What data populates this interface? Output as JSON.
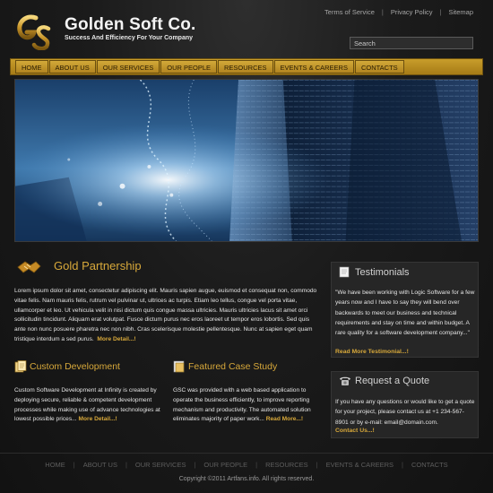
{
  "brand": {
    "name": "Golden Soft Co.",
    "tagline": "Success And Efficiency For Your Company",
    "colors": {
      "gold": "#d7a83a",
      "nav": "#b8891f"
    }
  },
  "top_links": [
    "Terms of Service",
    "Privacy Policy",
    "Sitemap"
  ],
  "search": {
    "placeholder": "Search"
  },
  "nav": [
    "HOME",
    "ABOUT US",
    "OUR SERVICES",
    "OUR PEOPLE",
    "RESOURCES",
    "EVENTS & CAREERS",
    "CONTACTS"
  ],
  "partnership": {
    "title": "Gold Partnership",
    "text": "Lorem ipsum dolor sit amet, consectetur adipiscing elit. Mauris sapien augue, euismod et consequat non, commodo vitae felis. Nam mauris felis, rutrum vel pulvinar ut, ultrices ac turpis. Etiam leo tellus, congue vel porta vitae, ullamcorper et leo. Ut vehicula velit in nisi dictum quis congue massa ultricies. Mauris ultricies lacus sit amet orci sollicitudin tincidunt. Aliquam erat volutpat. Fusce dictum purus nec eros laoreet ut tempor eros lobortis. Sed quis ante non nunc posuere pharetra nec non nibh. Cras scelerisque molestie pellentesque. Nunc at sapien eget quam tristique interdum a sed purus.",
    "more": "More Detail...!"
  },
  "custom_dev": {
    "title": "Custom Development",
    "text": "Custom Software Development at Infinity is created by deploying secure, reliable & competent development processes while making use of advance technologies at lowest possible prices...",
    "more": "More Detail...!"
  },
  "case_study": {
    "title": "Featured Case Study",
    "text": "GSC was provided with a web based application to operate the business efficiently, to improve reporting mechanism and productivity. The automated solution eliminates majority of paper work...",
    "more": "Read More...!"
  },
  "testimonials": {
    "title": "Testimonials",
    "text": "\"We have been working with Logic Software for a few years now and I have to say they will bend over backwards to meet our business and technical requirements and stay on time and within budget. A rare quality for a software development company...\"",
    "more": "Read More Testimonial...!"
  },
  "quote": {
    "title": "Request a Quote",
    "text": "If you have any questions or would like to get a quote for your project, please contact us at +1 234-567-8901 or by e-mail: email@domain.com.",
    "more": "Contact Us...!"
  },
  "footer": {
    "nav": [
      "HOME",
      "ABOUT US",
      "OUR SERVICES",
      "OUR PEOPLE",
      "RESOURCES",
      "EVENTS & CAREERS",
      "CONTACTS"
    ],
    "copyright": "Copyright ©2011 Artfans.info. All rights reserved."
  },
  "icons": [
    "gs-logo",
    "handshake-icon",
    "documents-icon",
    "folder-icon",
    "notepad-icon",
    "telephone-icon"
  ]
}
